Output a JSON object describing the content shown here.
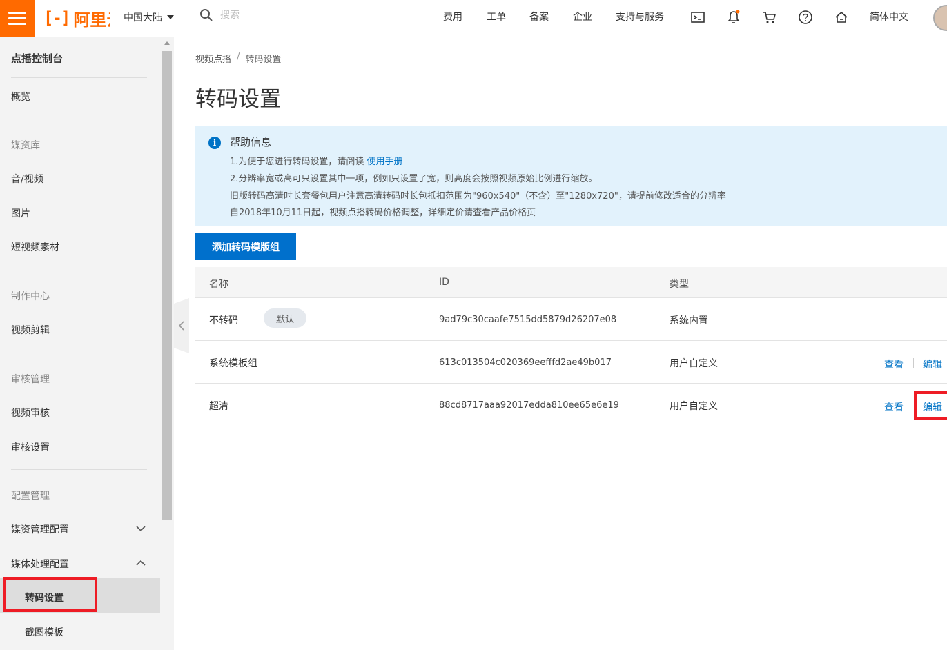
{
  "topbar": {
    "logo_text": "阿里云",
    "region": "中国大陆",
    "search_placeholder": "搜索",
    "nav": [
      "费用",
      "工单",
      "备案",
      "企业",
      "支持与服务"
    ],
    "language": "简体中文",
    "icons": [
      "terminal-icon",
      "bell-icon",
      "cart-icon",
      "help-icon",
      "home-icon"
    ],
    "accent_color": "#ff6a00"
  },
  "sidebar": {
    "title": "点播控制台",
    "overview": "概览",
    "group_media": "媒资库",
    "audio_video": "音/视频",
    "images": "图片",
    "short_video": "短视频素材",
    "group_production": "制作中心",
    "video_edit": "视频剪辑",
    "group_review": "审核管理",
    "video_review": "视频审核",
    "review_settings": "审核设置",
    "group_config": "配置管理",
    "media_config": "媒资管理配置",
    "processing_config": "媒体处理配置",
    "transcode_settings": "转码设置",
    "snapshot_templates": "截图模板"
  },
  "breadcrumb": {
    "root": "视频点播",
    "separator": "/",
    "current": "转码设置"
  },
  "page_title": "转码设置",
  "help": {
    "title": "帮助信息",
    "line1_prefix": "1.为便于您进行转码设置，请阅读",
    "line1_link": "使用手册",
    "line2": "2.分辨率宽或高可只设置其中一项，例如只设置了宽，则高度会按照视频原始比例进行缩放。",
    "line3": "旧版转码高清时长套餐包用户注意高清转码时长包抵扣范围为\"960x540\"（不含）至\"1280x720\"，请提前修改适合的分辨率",
    "line4": "自2018年10月11日起，视频点播转码价格调整，详细定价请查看产品价格页"
  },
  "add_button": "添加转码模版组",
  "table": {
    "headers": {
      "name": "名称",
      "id": "ID",
      "type": "类型"
    },
    "rows": [
      {
        "name": "不转码",
        "badge": "默认",
        "id": "9ad79c30caafe7515dd5879d26207e08",
        "type": "系统内置"
      },
      {
        "name": "系统模板组",
        "id": "613c013504c020369eefffd2ae49b017",
        "type": "用户自定义",
        "view": "查看",
        "edit": "编辑"
      },
      {
        "name": "超清",
        "id": "88cd8717aaa92017edda810ee65e6e19",
        "type": "用户自定义",
        "view": "查看",
        "edit": "编辑"
      }
    ]
  },
  "highlight_color": "#ee1c25",
  "link_color": "#0073c6"
}
